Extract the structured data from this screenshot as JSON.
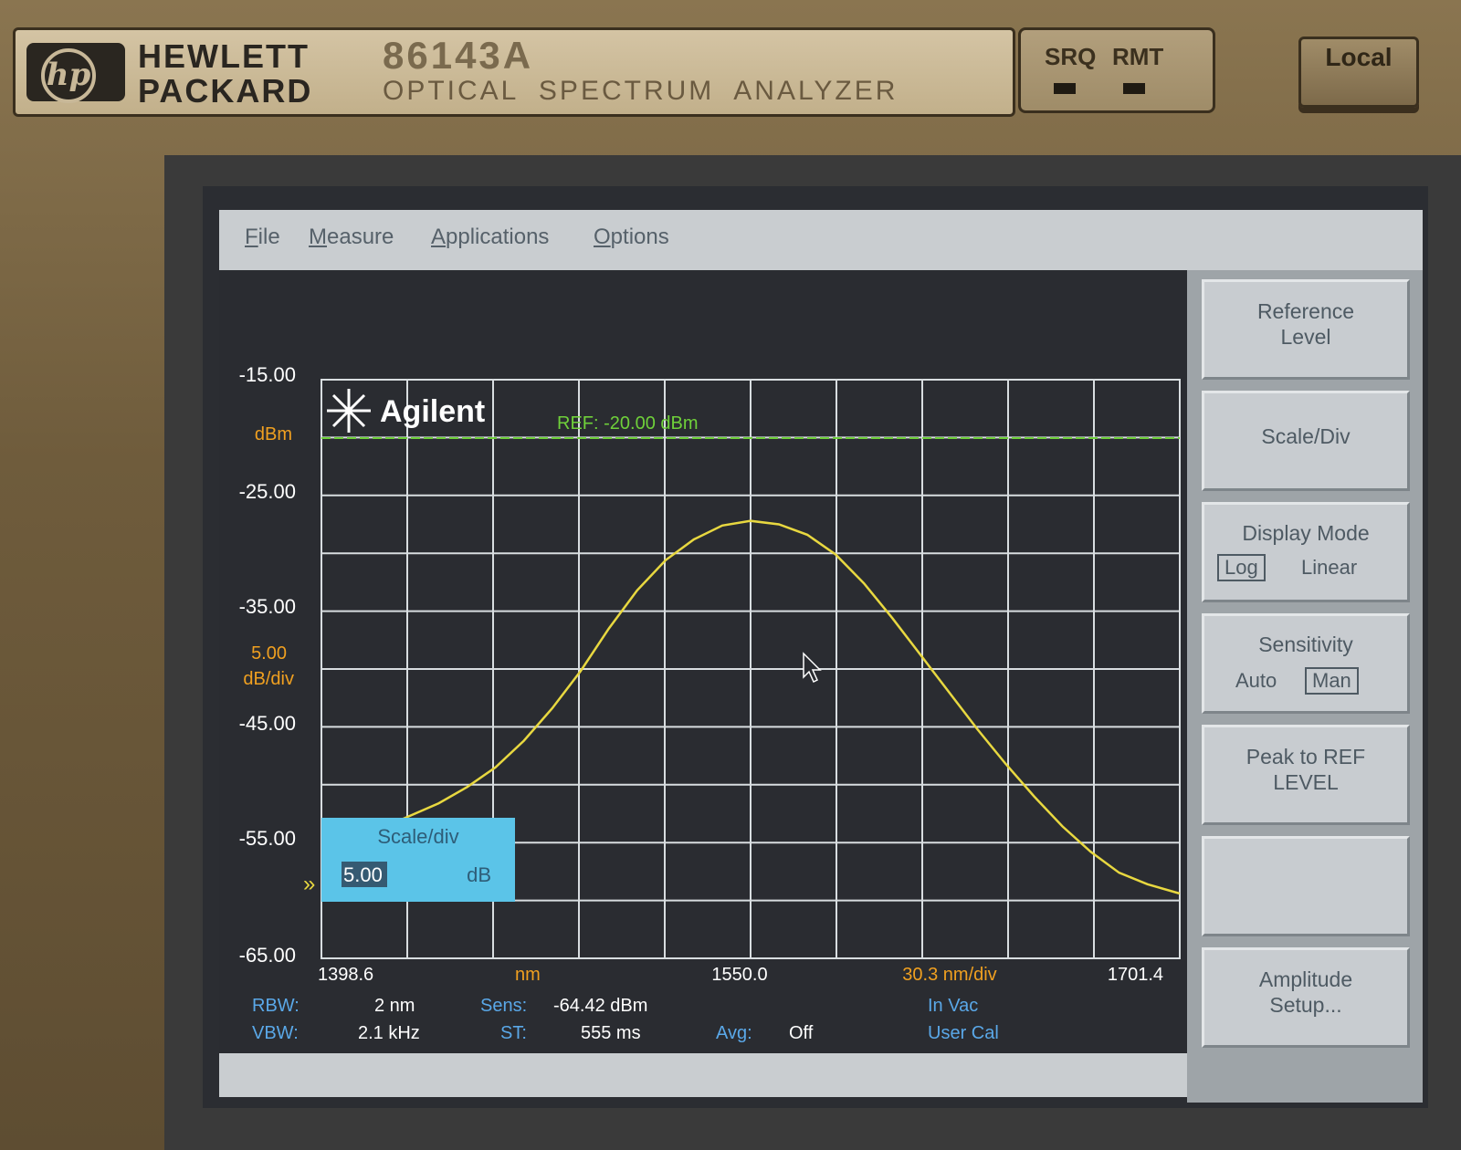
{
  "instrument": {
    "brand_line1": "HEWLETT",
    "brand_line2": "PACKARD",
    "logo_text": "hp",
    "model": "86143A",
    "product_name": "OPTICAL  SPECTRUM  ANALYZER",
    "srq_label": "SRQ",
    "rmt_label": "RMT",
    "local_button": "Local"
  },
  "menu": {
    "items": [
      "File",
      "Measure",
      "Applications",
      "Options"
    ]
  },
  "display": {
    "logo_text": "Agilent",
    "ref_line_label": "REF: -20.00 dBm",
    "y_unit": "dBm",
    "scale_value": "5.00",
    "scale_unit": "dB/div",
    "y_ticks": [
      "-15.00",
      "-25.00",
      "-35.00",
      "-45.00",
      "-55.00",
      "-65.00"
    ],
    "x_start": "1398.6",
    "x_unit": "nm",
    "x_center": "1550.0",
    "x_per_div": "30.3 nm/div",
    "x_stop": "1701.4",
    "scale_dialog": {
      "title": "Scale/div",
      "value": "5.00",
      "unit": "dB"
    },
    "status": {
      "rbw_label": "RBW:",
      "rbw_value": "2 nm",
      "vbw_label": "VBW:",
      "vbw_value": "2.1 kHz",
      "sens_label": "Sens:",
      "sens_value": "-64.42 dBm",
      "st_label": "ST:",
      "st_value": "555 ms",
      "avg_label": "Avg:",
      "avg_value": "Off",
      "vac_label": "In Vac",
      "cal_label": "User Cal"
    },
    "colors": {
      "trace": "#e8d840",
      "grid": "#d8dde0",
      "ref_line": "#6fd03a",
      "annotation_orange": "#f0a020",
      "status_blue": "#5aa8e8",
      "dialog_bg": "#5bc4e8"
    }
  },
  "softkeys": {
    "reference_level": "Reference Level",
    "scale_div": "Scale/Div",
    "display_mode": "Display Mode",
    "display_mode_log": "Log",
    "display_mode_linear": "Linear",
    "sensitivity": "Sensitivity",
    "sensitivity_auto": "Auto",
    "sensitivity_man": "Man",
    "peak_to_ref": "Peak to REF LEVEL",
    "blank": "",
    "amplitude_setup": "Amplitude Setup..."
  },
  "chart_data": {
    "type": "line",
    "title": "",
    "xlabel": "nm",
    "ylabel": "dBm",
    "xlim": [
      1398.6,
      1701.4
    ],
    "ylim": [
      -65,
      -15
    ],
    "grid": true,
    "x": [
      1425,
      1440,
      1450,
      1460,
      1470,
      1480,
      1490,
      1500,
      1510,
      1520,
      1530,
      1540,
      1550,
      1560,
      1570,
      1580,
      1590,
      1600,
      1610,
      1620,
      1630,
      1640,
      1650,
      1660,
      1670,
      1680,
      1690,
      1701.4
    ],
    "series": [
      {
        "values": [
          -53.2,
          -51.6,
          -50.2,
          -48.5,
          -46.2,
          -43.4,
          -40.2,
          -36.5,
          -33.2,
          -30.6,
          -28.8,
          -27.6,
          -27.2,
          -27.5,
          -28.4,
          -30.1,
          -32.6,
          -35.6,
          -38.8,
          -42.0,
          -45.2,
          -48.2,
          -51.0,
          -53.6,
          -55.8,
          -57.6,
          -58.6,
          -59.4
        ]
      }
    ]
  }
}
